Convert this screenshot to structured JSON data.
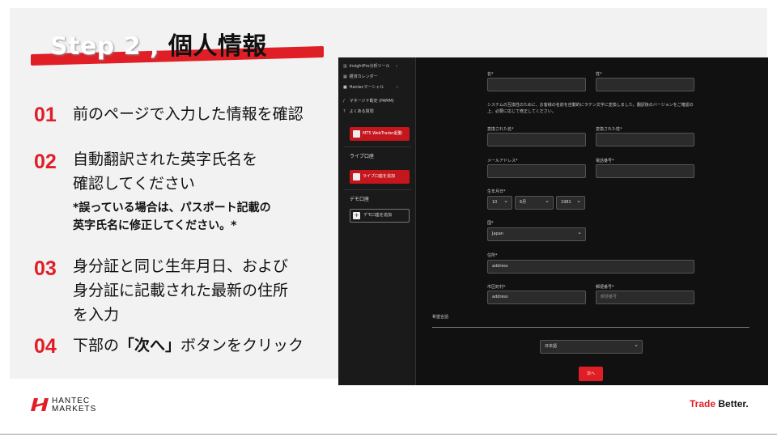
{
  "slide": {
    "title_en": "Step 2 ,",
    "title_jp": "個人情報"
  },
  "steps": [
    {
      "num": "01",
      "lines": [
        "前のページで入力した情報を確認"
      ]
    },
    {
      "num": "02",
      "lines": [
        "自動翻訳された英字氏名を",
        "確認してください"
      ],
      "note_lines": [
        "*誤っている場合は、パスポート記載の",
        "英字氏名に修正してください。*"
      ]
    },
    {
      "num": "03",
      "lines": [
        "身分証と同じ生年月日、および",
        "身分証に記載された最新の住所",
        "を入力"
      ]
    },
    {
      "num": "04",
      "pre": "下部の",
      "bold": "「次へ」",
      "post": "ボタンをクリック"
    }
  ],
  "screenshot": {
    "sidebar": {
      "items": [
        {
          "icon": "chart-icon",
          "label": "InsightPro分析ツール",
          "chev": "›"
        },
        {
          "icon": "calendar-icon",
          "label": "経済カレンダー",
          "chev": ""
        },
        {
          "icon": "news-icon",
          "label": "Hantecマーシャル",
          "chev": "›"
        },
        {
          "icon": "slash-icon",
          "label": "マネージド勘定 (PAMM)",
          "chev": ""
        },
        {
          "icon": "help-icon",
          "label": "よくある質問",
          "chev": ""
        }
      ],
      "mt5_button": "MT5 WebTrader起動",
      "live_heading": "ライブ口座",
      "live_add": "ライブ口座を追加",
      "demo_heading": "デモ口座",
      "demo_add": "デモ口座を追加"
    },
    "form": {
      "first_name_label": "名*",
      "last_name_label": "姓*",
      "note": "システムの互換性のために、お客様の名前を自動的にラテン文字に変換しました。翻訳後のバージョンをご確認の上、必要に応じて修正してください。",
      "converted_first_label": "変換された名*",
      "converted_last_label": "変換された姓*",
      "email_label": "メールアドレス*",
      "phone_label": "電話番号*",
      "dob_label": "生年月日*",
      "dob_day": "10",
      "dob_month": "6月",
      "dob_year": "1981",
      "country_label": "国*",
      "country_value": "Japan",
      "address_label": "住所*",
      "address_value": "address",
      "city_label": "市区町村*",
      "city_value": "address",
      "postal_label": "郵便番号*",
      "postal_placeholder": "郵便番号",
      "language_label": "希望言語",
      "language_value": "日本語",
      "next_button": "次へ"
    }
  },
  "footer": {
    "logo_line1": "HANTEC",
    "logo_line2": "MARKETS",
    "tagline_a": "Trade ",
    "tagline_b": "Better."
  },
  "colors": {
    "accent": "#e01e26",
    "panel": "#f2f2f2",
    "screenshot_bg": "#111111"
  }
}
